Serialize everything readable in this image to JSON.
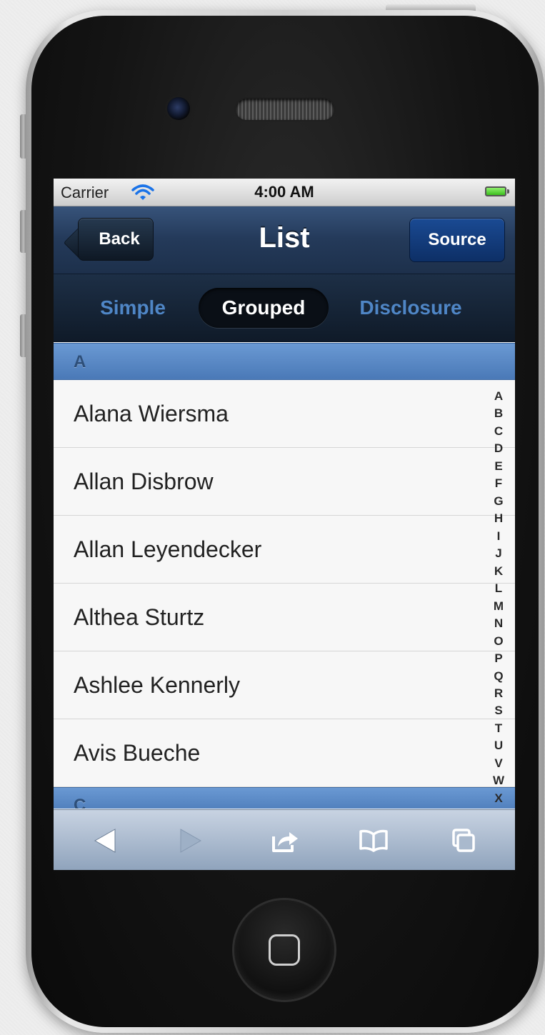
{
  "status_bar": {
    "carrier": "Carrier",
    "time": "4:00 AM"
  },
  "nav_bar": {
    "title": "List",
    "back_label": "Back",
    "source_label": "Source"
  },
  "segments": [
    {
      "label": "Simple",
      "active": false
    },
    {
      "label": "Grouped",
      "active": true
    },
    {
      "label": "Disclosure",
      "active": false
    }
  ],
  "sections": [
    {
      "header": "A",
      "items": [
        "Alana Wiersma",
        "Allan Disbrow",
        "Allan Leyendecker",
        "Althea Sturtz",
        "Ashlee Kennerly",
        "Avis Bueche"
      ]
    },
    {
      "header": "C",
      "items": []
    }
  ],
  "index_letters": [
    "A",
    "B",
    "C",
    "D",
    "E",
    "F",
    "G",
    "H",
    "I",
    "J",
    "K",
    "L",
    "M",
    "N",
    "O",
    "P",
    "Q",
    "R",
    "S",
    "T",
    "U",
    "V",
    "W",
    "X"
  ],
  "toolbar": {
    "icons": [
      "back-arrow-icon",
      "forward-arrow-icon",
      "share-icon",
      "bookmarks-icon",
      "tabs-icon"
    ]
  },
  "colors": {
    "nav_accent": "#243a5a",
    "segment_inactive": "#4f86c6",
    "section_header": "#5b8ac7",
    "source_button": "#0d2f66"
  }
}
